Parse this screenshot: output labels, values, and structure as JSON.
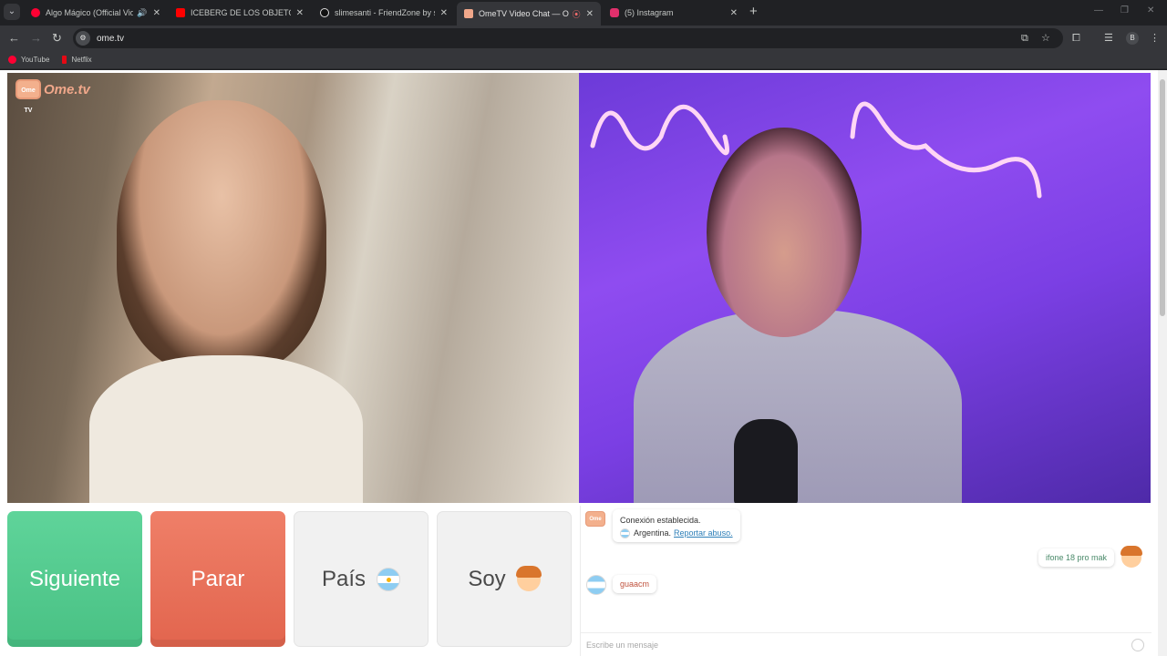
{
  "tabs": [
    {
      "title": "Algo Mágico (Official Video",
      "favicon_color": "#ff0033",
      "audio": "🔊",
      "active": false
    },
    {
      "title": "ICEBERG DE LOS OBJETOS PERD",
      "favicon_color": "#ff0000",
      "active": false
    },
    {
      "title": "slimesanti - FriendZone by slim",
      "favicon_color": "#ffffff",
      "active": false
    },
    {
      "title": "OmeTV Video Chat — Ome",
      "favicon_color": "#f0a78a",
      "recording": "⦿",
      "active": true
    },
    {
      "title": "(5) Instagram",
      "favicon_color": "#e1306c",
      "active": false
    }
  ],
  "toolbar": {
    "back": "←",
    "forward": "→",
    "reload": "↻",
    "url": "ome.tv",
    "profile_initial": "B"
  },
  "bookmarks": [
    {
      "label": "YouTube",
      "icon_color": "#ff0033"
    },
    {
      "label": "Netflix",
      "icon_color": "#e50914"
    }
  ],
  "app": {
    "logo_text": "Ome.tv",
    "logo_badge": "Ome TV"
  },
  "buttons": {
    "next_label": "Siguiente",
    "stop_label": "Parar",
    "country_label": "País",
    "me_label": "Soy"
  },
  "chat": {
    "system_line1": "Conexión establecida.",
    "system_country": "Argentina.",
    "report_link": "Reportar abuso.",
    "messages": [
      {
        "from": "me",
        "text": "ifone 18 pro mak"
      },
      {
        "from": "stranger",
        "text": "guaacm"
      }
    ],
    "input_placeholder": "Escribe un mensaje"
  }
}
